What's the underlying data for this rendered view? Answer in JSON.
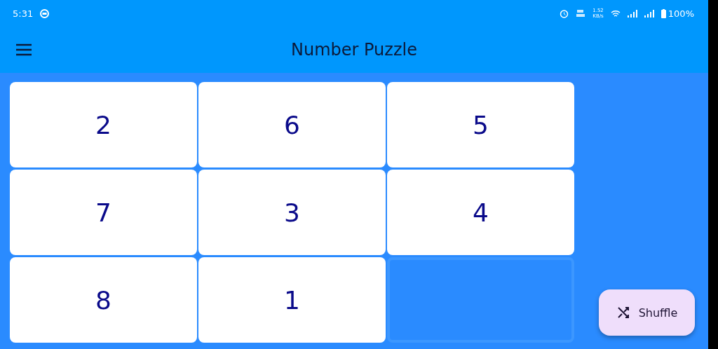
{
  "status_bar": {
    "time": "5:31",
    "net_speed": [
      "1.52",
      "KB/s"
    ],
    "battery": "100%"
  },
  "app_bar": {
    "title": "Number Puzzle"
  },
  "tiles": [
    {
      "kind": "number",
      "label": "2"
    },
    {
      "kind": "number",
      "label": "6"
    },
    {
      "kind": "number",
      "label": "5"
    },
    {
      "kind": "number",
      "label": "7"
    },
    {
      "kind": "number",
      "label": "3"
    },
    {
      "kind": "number",
      "label": "4"
    },
    {
      "kind": "number",
      "label": "8"
    },
    {
      "kind": "number",
      "label": "1"
    },
    {
      "kind": "empty"
    }
  ],
  "fab": {
    "label": "Shuffle"
  }
}
